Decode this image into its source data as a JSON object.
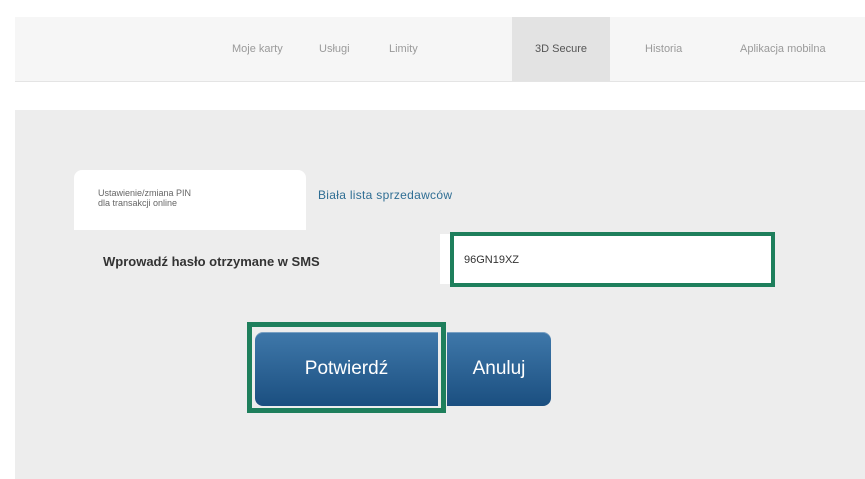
{
  "topnav": {
    "items": [
      {
        "label": "Moje karty"
      },
      {
        "label": "Usługi"
      },
      {
        "label": "Limity"
      },
      {
        "label": "3D Secure",
        "active": true
      },
      {
        "label": "Historia"
      },
      {
        "label": "Aplikacja mobilna"
      }
    ]
  },
  "subtabs": {
    "active_line1": "Ustawienie/zmiana PIN",
    "active_line2": "dla transakcji online",
    "other": "Biała lista sprzedawców"
  },
  "form": {
    "label": "Wprowadź hasło otrzymane w SMS",
    "sms_value": "96GN19XZ"
  },
  "buttons": {
    "confirm": "Potwierdź",
    "cancel": "Anuluj"
  },
  "colors": {
    "highlight": "#1e7f5c",
    "button": "#2a6194",
    "link": "#2f6e94"
  }
}
